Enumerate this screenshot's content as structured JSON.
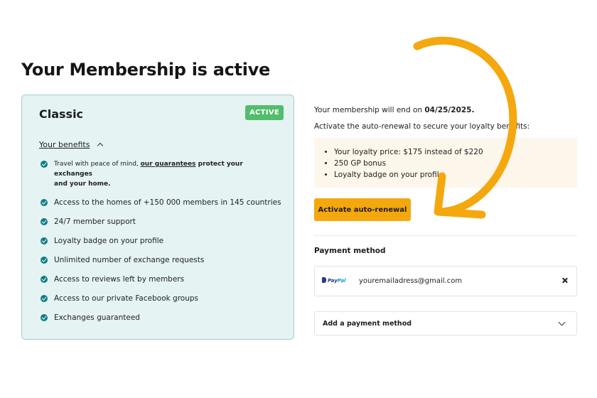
{
  "page": {
    "title": "Your Membership is active"
  },
  "plan": {
    "name": "Classic",
    "status_badge": "ACTIVE",
    "benefits_toggle_label": "Your benefits",
    "benefits": {
      "first_prefix": "Travel with peace of mind, ",
      "first_link": "our guarantees",
      "first_suffix": " protect your exchanges",
      "first_line2": "and your home.",
      "items": [
        "Access to the homes of +150 000 members in 145 countries",
        "24/7 member support",
        "Loyalty badge on your profile",
        "Unlimited number of exchange requests",
        "Access to reviews left by members",
        "Access to our private Facebook groups",
        "Exchanges guaranteed"
      ]
    }
  },
  "renewal": {
    "end_text": "Your membership will end on ",
    "end_date": "04/25/2025.",
    "cta_text": "Activate the auto-renewal to secure your loyalty benefits:",
    "loyalty_items": [
      "Your loyalty price: $175 instead of $220",
      "250 GP bonus",
      "Loyalty badge on your profile"
    ],
    "button_label": "Activate auto-renewal"
  },
  "payment": {
    "title": "Payment method",
    "method": {
      "logo_text_1": "Pay",
      "logo_text_2": "Pal",
      "email": "youremailadress@gmail.com",
      "remove_icon": "close-icon"
    },
    "add_label": "Add a payment method"
  },
  "colors": {
    "accent": "#f4a80e",
    "badge": "#52bd6d",
    "check": "#107d82",
    "card_bg": "#e6f3f3"
  }
}
